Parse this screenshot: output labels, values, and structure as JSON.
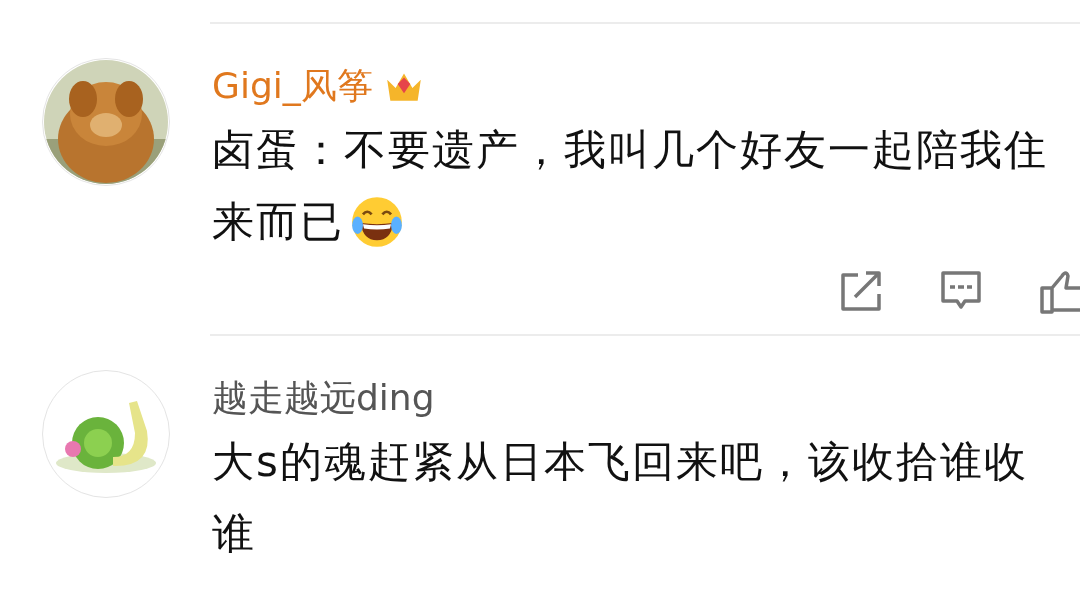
{
  "comments": [
    {
      "name": "Gigi_风筝",
      "vip": true,
      "avatar": {
        "kind": "picture"
      },
      "lines": [
        {
          "text": "卤蛋：不要遗产，我叫几个好友一起陪我住",
          "emoji": false
        },
        {
          "text": "来而已",
          "emoji": true
        }
      ],
      "actions": [
        {
          "kind": "share"
        },
        {
          "kind": "comment"
        },
        {
          "kind": "like"
        }
      ]
    },
    {
      "name": "越走越远ding",
      "vip": false,
      "avatar": {
        "kind": "picture"
      },
      "lines": [
        {
          "text": "大s的魂赶紧从日本飞回来吧，该收拾谁收",
          "emoji": false
        },
        {
          "text": "谁",
          "emoji": false
        }
      ]
    }
  ]
}
